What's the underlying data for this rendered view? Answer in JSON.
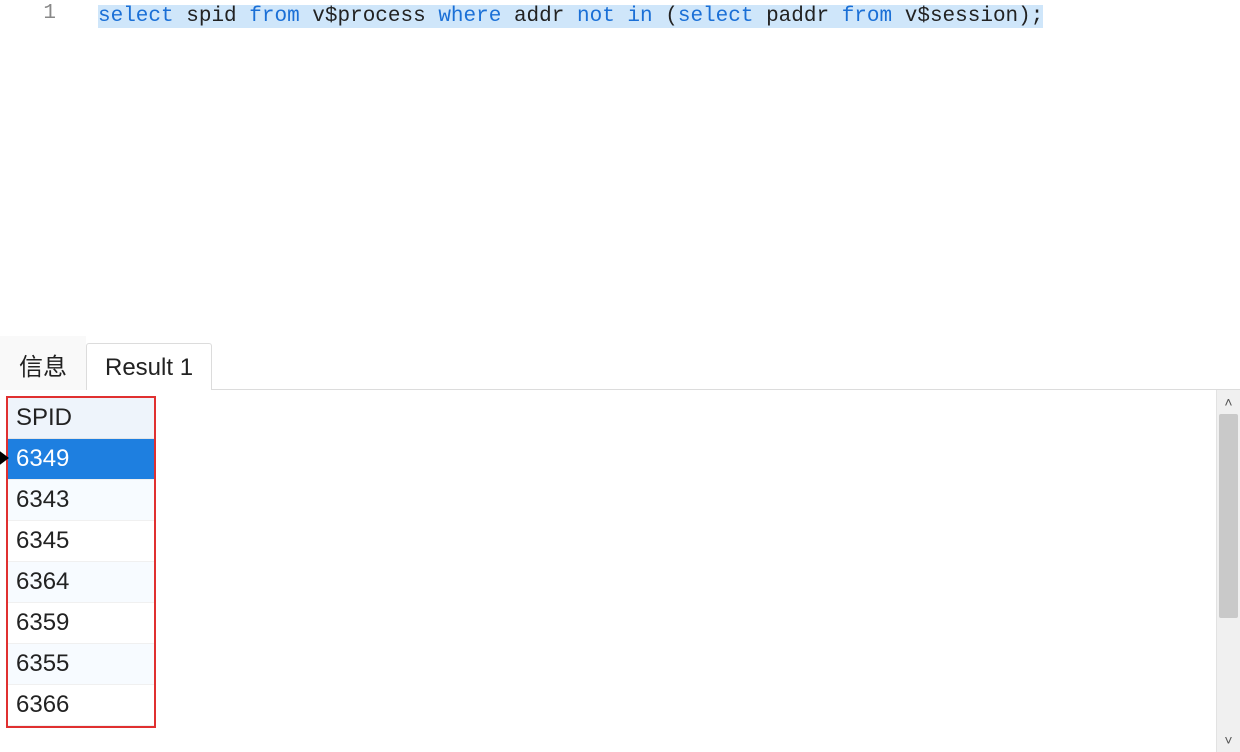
{
  "editor": {
    "line_number": "1",
    "tokens": [
      {
        "t": "select",
        "c": "kw"
      },
      {
        "t": " ",
        "c": "id"
      },
      {
        "t": "spid",
        "c": "id"
      },
      {
        "t": " ",
        "c": "id"
      },
      {
        "t": "from",
        "c": "kw"
      },
      {
        "t": " ",
        "c": "id"
      },
      {
        "t": "v$process",
        "c": "id"
      },
      {
        "t": " ",
        "c": "id"
      },
      {
        "t": "where",
        "c": "kw"
      },
      {
        "t": " ",
        "c": "id"
      },
      {
        "t": "addr",
        "c": "id"
      },
      {
        "t": " ",
        "c": "id"
      },
      {
        "t": "not",
        "c": "kw"
      },
      {
        "t": " ",
        "c": "id"
      },
      {
        "t": "in",
        "c": "kw"
      },
      {
        "t": " ",
        "c": "id"
      },
      {
        "t": "(",
        "c": "delim"
      },
      {
        "t": "select",
        "c": "kw"
      },
      {
        "t": " ",
        "c": "id"
      },
      {
        "t": "paddr",
        "c": "id"
      },
      {
        "t": " ",
        "c": "id"
      },
      {
        "t": "from",
        "c": "kw"
      },
      {
        "t": " ",
        "c": "id"
      },
      {
        "t": "v$session",
        "c": "id"
      },
      {
        "t": ")",
        "c": "delim"
      },
      {
        "t": ";",
        "c": "delim"
      }
    ]
  },
  "tabs": {
    "info": "信息",
    "result1": "Result 1"
  },
  "results": {
    "column": "SPID",
    "rows": [
      {
        "v": "6349",
        "selected": true
      },
      {
        "v": "6343",
        "selected": false
      },
      {
        "v": "6345",
        "selected": false
      },
      {
        "v": "6364",
        "selected": false
      },
      {
        "v": "6359",
        "selected": false
      },
      {
        "v": "6355",
        "selected": false
      },
      {
        "v": "6366",
        "selected": false
      }
    ]
  },
  "scroll": {
    "up": "˄",
    "down": "˅"
  }
}
